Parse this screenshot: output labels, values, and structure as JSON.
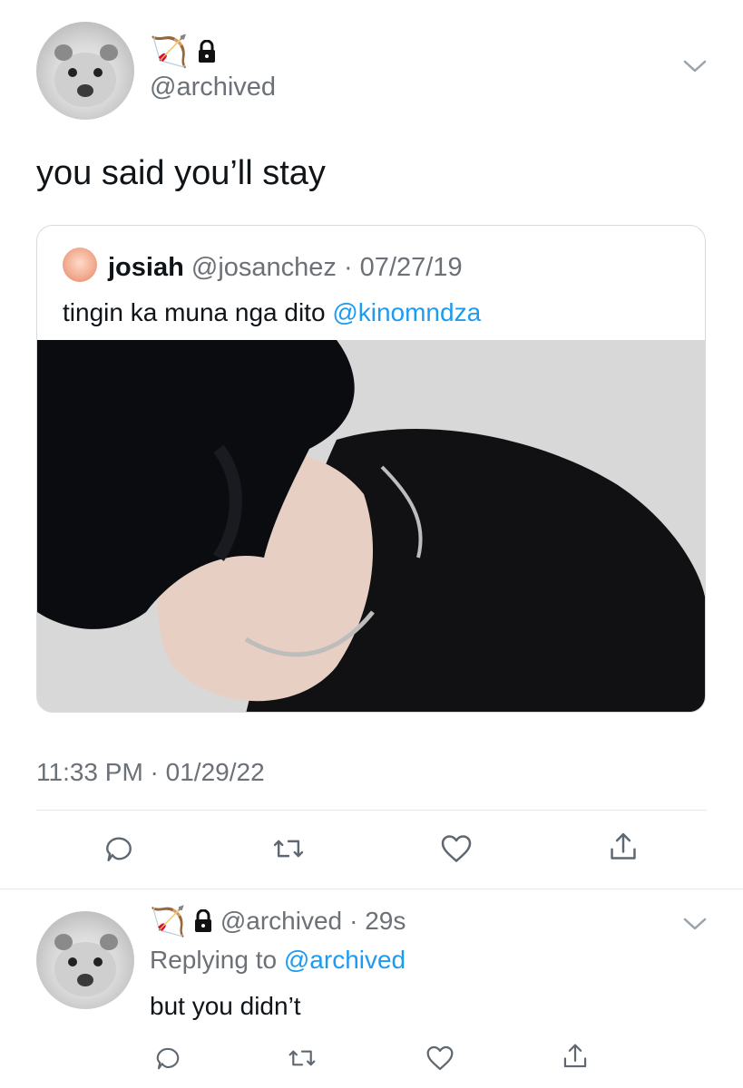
{
  "main_tweet": {
    "display_emoji": "🏹",
    "lock_icon": "lock-icon",
    "handle": "@archived",
    "text": "you said you’ll stay",
    "timestamp": "11:33 PM · 01/29/22"
  },
  "quoted_tweet": {
    "name": "josiah",
    "handle": "@josanchez",
    "date": "· 07/27/19",
    "text_prefix": "tingin ka muna nga dito",
    "mention": "@kinomndza"
  },
  "actions": {
    "reply_icon": "reply-icon",
    "retweet_icon": "retweet-icon",
    "like_icon": "heart-icon",
    "share_icon": "share-icon"
  },
  "reply_tweet": {
    "display_emoji": "🏹",
    "handle": "@archived",
    "time": "· 29s",
    "replying_prefix": "Replying to",
    "replying_handle": "@archived",
    "text": "but you didn’t"
  },
  "colors": {
    "link": "#1d9bf0",
    "muted": "#6b7177",
    "text": "#0f1419"
  }
}
